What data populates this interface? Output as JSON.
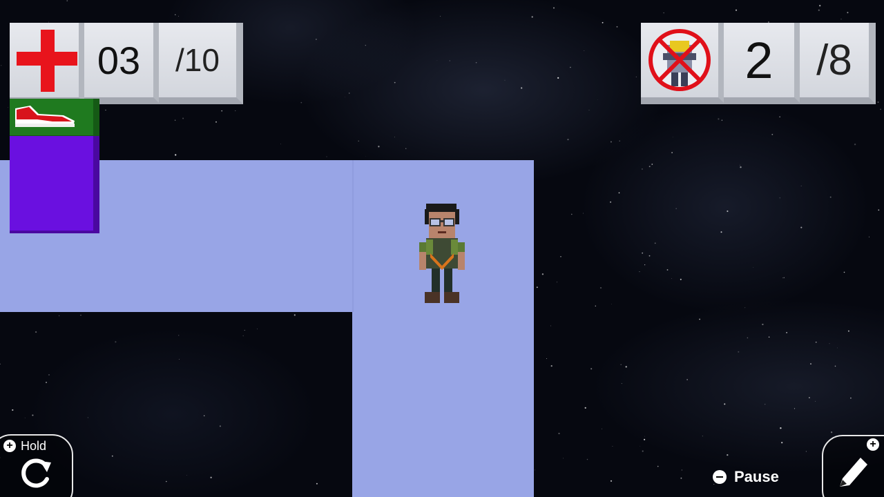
{
  "hud": {
    "health": {
      "icon": "red-cross-icon",
      "current": "03",
      "max": "/10"
    },
    "enemies": {
      "icon": "crossed-out-enemy-icon",
      "current": "2",
      "max": "/8"
    },
    "powerups": [
      {
        "icon": "sneaker-icon",
        "color": "#1f7a1f"
      },
      {
        "icon": "empty-slot",
        "color": "#6a10e0"
      }
    ]
  },
  "controls": {
    "hold_label": "Hold",
    "hold_icon": "rotate-icon",
    "pause_label": "Pause",
    "edit_icon": "pencil-icon"
  },
  "colors": {
    "floor": "#98a5e6",
    "space": "#060810",
    "health_cross": "#e8141c"
  }
}
